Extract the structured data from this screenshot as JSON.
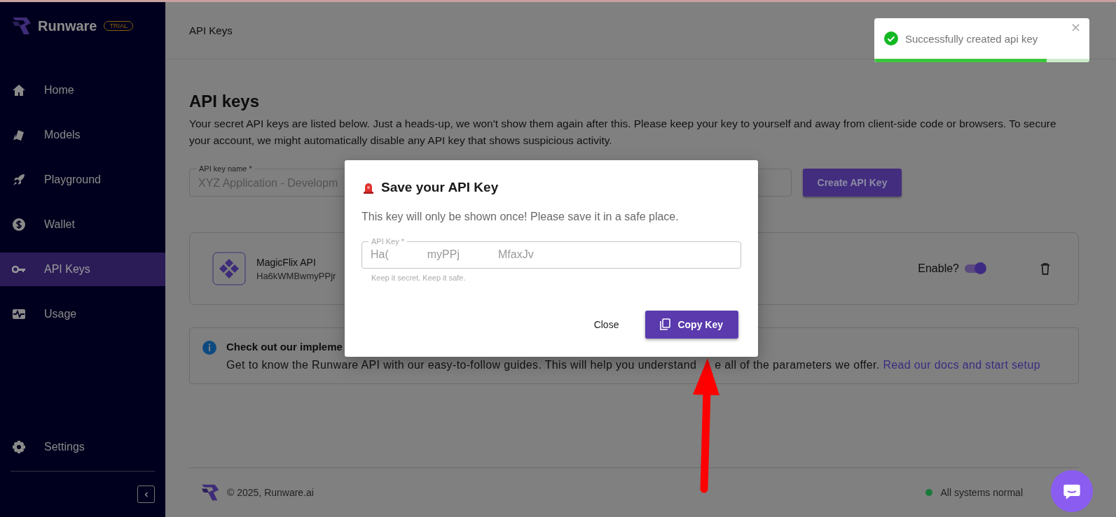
{
  "sidebar": {
    "brand": "Runware",
    "badge": "TRIAL",
    "items": [
      {
        "label": "Home",
        "selected": false
      },
      {
        "label": "Models",
        "selected": false
      },
      {
        "label": "Playground",
        "selected": false
      },
      {
        "label": "Wallet",
        "selected": false
      },
      {
        "label": "API Keys",
        "selected": true
      },
      {
        "label": "Usage",
        "selected": false
      }
    ],
    "bottom_items": [
      {
        "label": "Settings",
        "selected": false
      }
    ]
  },
  "header": {
    "title": "API Keys"
  },
  "page": {
    "title": "API keys",
    "description": "Your secret API keys are listed below. Just a heads-up, we won't show them again after this. Please keep your key to yourself and away from client-side code or browsers. To secure your account, we might automatically disable any API key that shows suspicious activity.",
    "name_field": {
      "label": "API key name *",
      "placeholder": "XYZ Application - Developm"
    },
    "create_button": "Create API Key",
    "keys": [
      {
        "name": "MagicFlix API",
        "key": "Ha6kWMBwmyPPjr",
        "enable_label": "Enable?",
        "enabled": true
      }
    ],
    "info": {
      "title": "Check out our impleme",
      "body": "Get to know the Runware API with our easy-to-follow guides. This will help you understand",
      "body_after_arrow": "e all of the parameters we offer.",
      "link": "Read our docs and start setup"
    }
  },
  "footer": {
    "copyright": "© 2025, Runware.ai",
    "status": "All systems normal"
  },
  "dialog": {
    "title": "Save your API Key",
    "message": "This key will only be shown once! Please save it in a safe place.",
    "field": {
      "label": "API Key *",
      "value_segments": [
        "Ha(",
        "myPPj",
        "MfaxJv"
      ],
      "helper": "Keep it secret. Keep it safe."
    },
    "buttons": [
      {
        "label": "Close",
        "kind": "text"
      },
      {
        "label": "Copy Key",
        "kind": "primary"
      }
    ]
  },
  "toast": {
    "message": "Successfully created api key",
    "close": "×",
    "level": 0.8
  }
}
